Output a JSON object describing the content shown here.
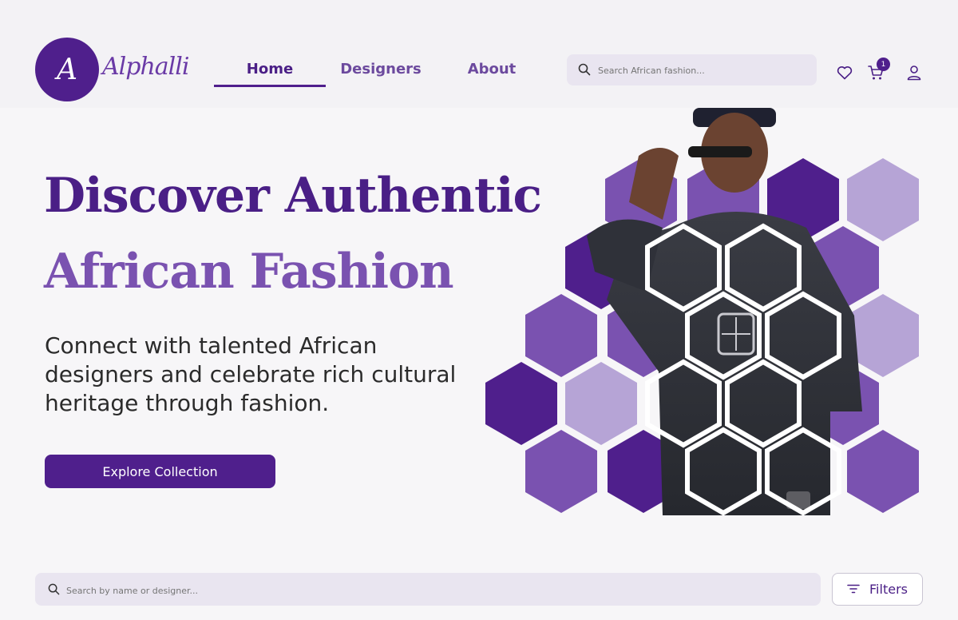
{
  "brand": {
    "logo_letter": "A",
    "logo_word": "Alphalli",
    "primary_color": "#4f1f8c",
    "secondary_color": "#7a52b0",
    "light_color": "#b6a4d6"
  },
  "nav": {
    "items": [
      {
        "label": "Home",
        "active": true
      },
      {
        "label": "Designers",
        "active": false
      },
      {
        "label": "About",
        "active": false
      }
    ]
  },
  "header_search": {
    "placeholder": "Search African fashion..."
  },
  "header_icons": {
    "wishlist": "heart-icon",
    "cart": "cart-icon",
    "cart_count": "1",
    "account": "user-icon"
  },
  "hero": {
    "title_line1": "Discover Authentic",
    "title_line2": "African Fashion",
    "subtitle": "Connect with talented African designers and celebrate rich cultural heritage through fashion.",
    "cta_label": "Explore Collection",
    "image": "hexagon-collage-model-photo"
  },
  "catalog_search": {
    "placeholder": "Search by name or designer...",
    "filters_label": "Filters",
    "filters_icon": "filter-icon"
  }
}
